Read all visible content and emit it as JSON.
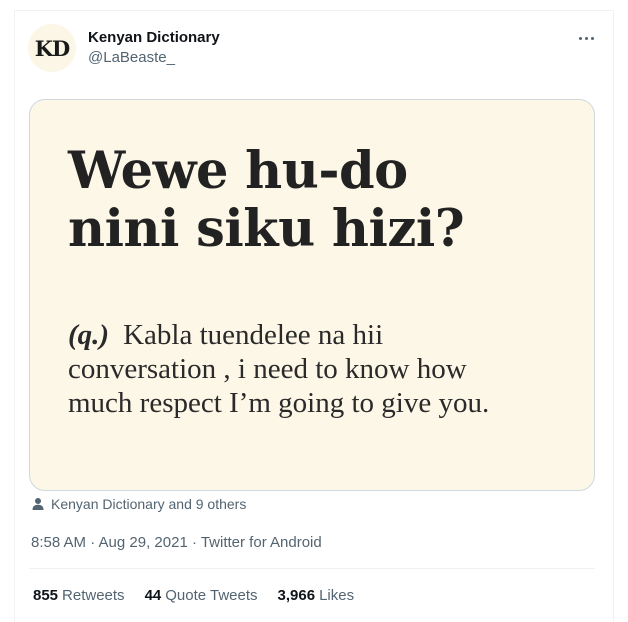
{
  "tweet": {
    "author": {
      "avatar_text": "KD",
      "name": "Kenyan Dictionary",
      "handle": "@LaBeaste_"
    },
    "more_icon": "more-horizontal-icon",
    "card": {
      "headline_line1": "Wewe hu-do",
      "headline_line2": "nini siku hizi?",
      "part_of_speech": "(q.)",
      "definition_line1": "Kabla tuendelee na hii",
      "definition_line2": "conversation , i need to know how",
      "definition_line3": "much respect I’m going to give you."
    },
    "social_context": {
      "icon": "person-icon",
      "text": "Kenyan Dictionary and 9 others"
    },
    "meta": "8:58 AM · Aug 29, 2021 · Twitter for Android",
    "stats": {
      "retweets_count": "855",
      "retweets_label": "Retweets",
      "quotes_count": "44",
      "quotes_label": "Quote Tweets",
      "likes_count": "3,966",
      "likes_label": "Likes"
    }
  }
}
